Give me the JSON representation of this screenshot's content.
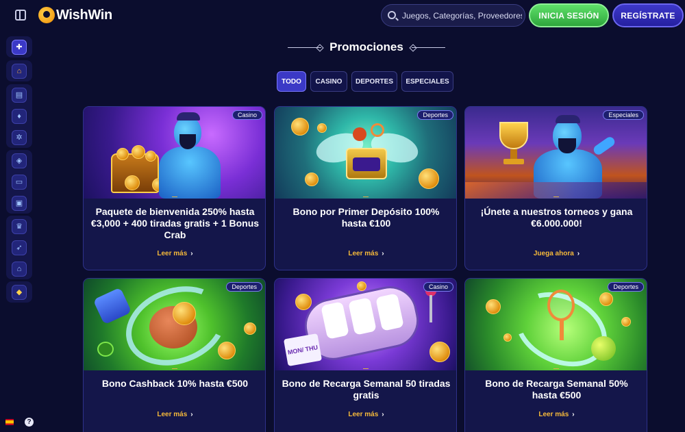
{
  "header": {
    "logo_text": "WishWin",
    "search_placeholder": "Juegos, Categorías, Proveedores",
    "login_label": "INICIA SESIÓN",
    "register_label": "REGÍSTRATE"
  },
  "sidebar": {
    "items": [
      {
        "icon": "gift-icon",
        "glyph": "🎁"
      },
      {
        "icon": "home-icon",
        "glyph": "⌂"
      },
      {
        "icon": "slots-icon",
        "glyph": "▤"
      },
      {
        "icon": "cards-icon",
        "glyph": "♦"
      },
      {
        "icon": "roulette-icon",
        "glyph": "✲"
      },
      {
        "icon": "sports-ball-icon",
        "glyph": "◈"
      },
      {
        "icon": "live-casino-icon",
        "glyph": "▭"
      },
      {
        "icon": "virtual-sports-icon",
        "glyph": "▣"
      },
      {
        "icon": "trophy-icon",
        "glyph": "♛"
      },
      {
        "icon": "rocket-icon",
        "glyph": "➶"
      },
      {
        "icon": "shop-icon",
        "glyph": "⌂"
      },
      {
        "icon": "vip-diamond-icon",
        "glyph": "◆"
      }
    ],
    "help_glyph": "?"
  },
  "main": {
    "title": "Promociones",
    "tabs": [
      {
        "label": "TODO",
        "active": true
      },
      {
        "label": "CASINO",
        "active": false
      },
      {
        "label": "DEPORTES",
        "active": false
      },
      {
        "label": "ESPECIALES",
        "active": false
      }
    ],
    "cards": [
      {
        "badge": "Casino",
        "title": "Paquete de bienvenida 250% hasta €3,000 + 400 tiradas gratis + 1 Bonus Crab",
        "link": "Leer más"
      },
      {
        "badge": "Deportes",
        "title": "Bono por Primer Depósito 100% hasta €100",
        "link": "Leer más"
      },
      {
        "badge": "Especiales",
        "title": "¡Únete a nuestros torneos y gana €6.000.000!",
        "link": "Juega ahora"
      },
      {
        "badge": "Deportes",
        "title": "Bono Cashback 10% hasta €500",
        "link": "Leer más"
      },
      {
        "badge": "Casino",
        "title": "Bono de Recarga Semanal 50 tiradas gratis",
        "link": "Leer más"
      },
      {
        "badge": "Deportes",
        "title": "Bono de Recarga Semanal 50% hasta €500",
        "link": "Leer más"
      }
    ],
    "slot_sign_text": "MON/ THU",
    "link_chevron": "›"
  },
  "colors": {
    "background": "#0b0d2e",
    "accent_purple": "#3b39c6",
    "login_green": "#3fc64c",
    "link_gold": "#f5b93a"
  }
}
